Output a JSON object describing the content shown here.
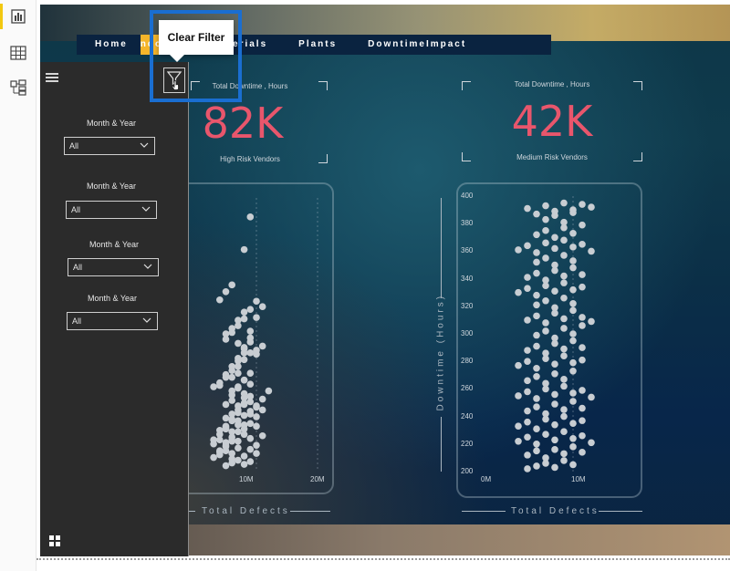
{
  "rail": {
    "icons": [
      "report-view-icon",
      "data-view-icon",
      "model-view-icon"
    ]
  },
  "nav": {
    "items": [
      "Home",
      "Vendors",
      "Materials",
      "Plants",
      "DowntimeImpact"
    ],
    "active_index": 1,
    "active_label_visible": "ndors"
  },
  "tooltip": {
    "text": "Clear Filter"
  },
  "slicers": [
    {
      "label": "Month & Year",
      "value": "All"
    },
    {
      "label": "Month & Year",
      "value": "All"
    },
    {
      "label": "Month & Year",
      "value": "All"
    },
    {
      "label": "Month & Year",
      "value": "All"
    }
  ],
  "kpis": [
    {
      "title": "Total Downtime , Hours",
      "value": "82K",
      "subtitle": "High Risk Vendors"
    },
    {
      "title": "Total Downtime , Hours",
      "value": "42K",
      "subtitle": "Medium Risk Vendors"
    }
  ],
  "colors": {
    "kpi": "#e8566c",
    "nav_active": "#f5b52a",
    "tooltip_border": "#1a6ed1",
    "points": "#c8cdd2"
  },
  "chart_data": [
    {
      "type": "scatter",
      "xlabel": "Total Defects",
      "ylabel": "Downtime (Hours)",
      "x_ticks": [
        "10M",
        "20M"
      ],
      "xlim": [
        0,
        20
      ],
      "ylim": [
        200,
        400
      ],
      "points_x": [
        5,
        6,
        6,
        7,
        8,
        9,
        4,
        5,
        6,
        7,
        8,
        9,
        10,
        3,
        4,
        5,
        6,
        7,
        8,
        9,
        10,
        11,
        4,
        5,
        6,
        7,
        8,
        9,
        10,
        5,
        6,
        7,
        8,
        9,
        10,
        11,
        5,
        6,
        7,
        8,
        9,
        10,
        6,
        7,
        8,
        9,
        6,
        7,
        8,
        7,
        8,
        9,
        8,
        7,
        9,
        10,
        3,
        4,
        5,
        6,
        7,
        8,
        9,
        3,
        4,
        5,
        6,
        7,
        8,
        4,
        5,
        6,
        7,
        8,
        9,
        5,
        6,
        7,
        8,
        6,
        7,
        8,
        9,
        10,
        11,
        5,
        6,
        7,
        8,
        9,
        4,
        5,
        6,
        7,
        3,
        4,
        5,
        6,
        8,
        9,
        10,
        11,
        12,
        5,
        6,
        7,
        8,
        9,
        10,
        4,
        5,
        6,
        9,
        10,
        11,
        8,
        9
      ],
      "points_y": [
        203,
        205,
        208,
        207,
        204,
        206,
        211,
        214,
        212,
        216,
        210,
        215,
        212,
        219,
        222,
        220,
        224,
        221,
        226,
        223,
        218,
        225,
        229,
        231,
        228,
        233,
        230,
        234,
        232,
        238,
        241,
        236,
        240,
        243,
        239,
        244,
        248,
        251,
        247,
        253,
        250,
        246,
        258,
        261,
        256,
        263,
        268,
        271,
        266,
        276,
        281,
        286,
        290,
        293,
        297,
        288,
        222,
        226,
        232,
        237,
        244,
        249,
        254,
        261,
        264,
        270,
        276,
        282,
        286,
        262,
        268,
        273,
        280,
        289,
        294,
        300,
        304,
        310,
        316,
        255,
        260,
        266,
        271,
        285,
        291,
        230,
        236,
        242,
        248,
        254,
        214,
        218,
        222,
        228,
        209,
        213,
        217,
        221,
        233,
        241,
        247,
        252,
        258,
        296,
        301,
        306,
        311,
        318,
        324,
        325,
        331,
        336,
        302,
        312,
        320,
        362,
        386
      ]
    },
    {
      "type": "scatter",
      "xlabel": "Total Defects",
      "ylabel": "Downtime (Hours)",
      "x_ticks": [
        "0M",
        "10M"
      ],
      "y_ticks": [
        "200",
        "220",
        "240",
        "260",
        "280",
        "300",
        "320",
        "340",
        "360",
        "380",
        "400"
      ],
      "xlim": [
        0,
        15
      ],
      "ylim": [
        200,
        400
      ],
      "points_x": [
        5,
        6,
        7,
        8,
        9,
        10,
        5,
        6,
        7,
        8,
        9,
        10,
        11,
        4,
        5,
        6,
        7,
        8,
        9,
        10,
        11,
        12,
        4,
        5,
        6,
        7,
        8,
        9,
        10,
        11,
        5,
        6,
        7,
        8,
        9,
        10,
        11,
        4,
        5,
        6,
        7,
        8,
        9,
        10,
        11,
        12,
        5,
        6,
        7,
        8,
        9,
        10,
        4,
        5,
        6,
        7,
        8,
        9,
        10,
        11,
        5,
        6,
        7,
        8,
        9,
        10,
        11,
        6,
        7,
        8,
        9,
        10,
        11,
        5,
        6,
        7,
        8,
        9,
        10,
        11,
        12,
        6,
        7,
        8,
        9,
        10,
        4,
        5,
        6,
        7,
        8,
        9,
        10,
        11,
        5,
        6,
        7,
        8,
        9,
        10,
        11,
        6,
        7,
        8,
        9,
        10,
        4,
        5,
        6,
        7,
        8,
        9,
        10,
        11,
        12,
        6,
        7,
        8,
        9,
        10,
        11,
        7,
        8,
        9,
        10,
        5,
        6,
        7,
        8,
        9,
        10,
        11,
        12
      ],
      "points_y": [
        202,
        204,
        206,
        203,
        208,
        205,
        212,
        215,
        210,
        216,
        213,
        218,
        214,
        222,
        225,
        220,
        227,
        223,
        229,
        224,
        226,
        221,
        233,
        236,
        231,
        238,
        234,
        240,
        235,
        237,
        244,
        247,
        242,
        249,
        245,
        251,
        246,
        255,
        258,
        253,
        260,
        256,
        262,
        257,
        259,
        254,
        266,
        269,
        264,
        271,
        267,
        273,
        277,
        280,
        275,
        282,
        278,
        284,
        279,
        281,
        288,
        291,
        286,
        293,
        289,
        295,
        290,
        299,
        302,
        297,
        304,
        300,
        306,
        310,
        313,
        308,
        315,
        311,
        317,
        312,
        309,
        321,
        324,
        319,
        326,
        322,
        330,
        333,
        328,
        335,
        331,
        337,
        332,
        334,
        341,
        344,
        339,
        346,
        342,
        348,
        343,
        352,
        355,
        350,
        357,
        353,
        361,
        364,
        359,
        366,
        362,
        368,
        363,
        365,
        360,
        372,
        375,
        370,
        377,
        373,
        379,
        383,
        386,
        381,
        388,
        391,
        387,
        393,
        389,
        395,
        390,
        394,
        392
      ]
    }
  ]
}
